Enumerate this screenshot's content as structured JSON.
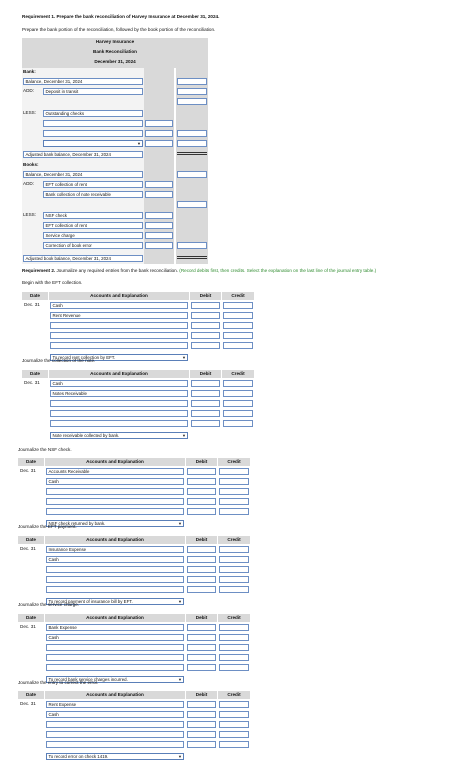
{
  "req1": {
    "title": "Requirement 1. Prepare the bank reconciliation of Harvey Insurance at December 31, 2024.",
    "subtitle": "Prepare the bank portion of the reconciliation, followed by the book portion of the reconciliation.",
    "company": "Harvey Insurance",
    "report": "Bank Reconciliation",
    "date": "December 31, 2024",
    "bank_label": "Bank:",
    "bank_balance": "Balance, December 31, 2024",
    "add_label": "ADD:",
    "deposit_in_transit": "Deposit in transit",
    "less_label": "LESS:",
    "outstanding_checks": "Outstanding checks",
    "adjusted_bank": "Adjusted bank balance, December 31, 2024",
    "books_label": "Books:",
    "book_balance": "Balance, December 31, 2024",
    "eft_rent": "EFT collection of rent",
    "bank_note": "Bank collection of note receivable",
    "nsf_check": "NSF check",
    "eft_collection_rent": "EFT collection of rent",
    "service_charge": "Service charge",
    "correction": "Correction of book error",
    "adjusted_book": "Adjusted book balance, December 31, 2024",
    "dropdown_arrow": "▼"
  },
  "req2": {
    "title_bold": "Requirement 2.",
    "title_rest": " Journalize any required entries from the bank reconciliation.",
    "title_note": "(Record debits first, then credits. Select the explanation on the last line of the journal entry table.)",
    "begin": "Begin with the EFT collection."
  },
  "columns": {
    "date": "Date",
    "accounts": "Accounts and Explanation",
    "debit": "Debit",
    "credit": "Credit"
  },
  "journals": [
    {
      "date": "Dec. 31",
      "debit_account": "Cash",
      "credit_account": "Rent Revenue",
      "explanation": "To record rent collection by EFT."
    },
    {
      "intro": "Journalize the collection of the note.",
      "date": "Dec. 31",
      "debit_account": "Cash",
      "credit_account": "Notes Receivable",
      "explanation": "Note receivable collected by bank."
    },
    {
      "intro": "Journalize the NSF check.",
      "date": "Dec. 31",
      "debit_account": "Accounts Receivable",
      "credit_account": "Cash",
      "explanation": "NSF check returned by bank."
    },
    {
      "intro": "Journalize the EFT payment.",
      "date": "Dec. 31",
      "debit_account": "Insurance Expense",
      "credit_account": "Cash",
      "explanation": "To record payment of insurance bill by EFT."
    },
    {
      "intro": "Journalize the service charge.",
      "date": "Dec. 31",
      "debit_account": "Bank Expense",
      "credit_account": "Cash",
      "explanation": "To record bank service charges incurred."
    },
    {
      "intro": "Journalize the entry to correct the error.",
      "date": "Dec. 31",
      "debit_account": "Rent Expense",
      "credit_account": "Cash",
      "explanation": "To record error on check 1419."
    }
  ]
}
